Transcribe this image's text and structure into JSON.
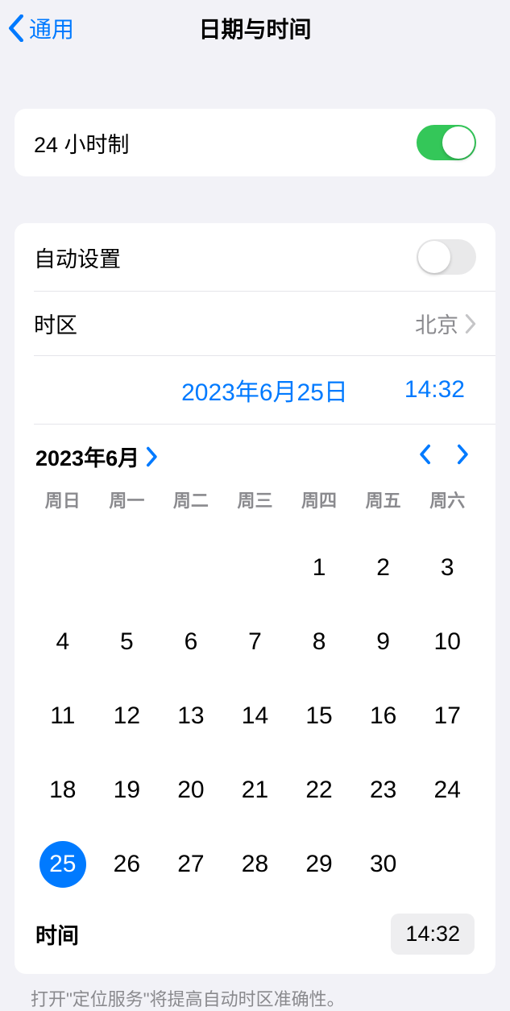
{
  "nav": {
    "back": "通用",
    "title": "日期与时间"
  },
  "s24": {
    "label": "24 小时制",
    "on": true
  },
  "auto": {
    "label": "自动设置",
    "on": false
  },
  "tz": {
    "label": "时区",
    "value": "北京"
  },
  "current": {
    "date": "2023年6月25日",
    "time": "14:32"
  },
  "cal": {
    "month_label": "2023年6月",
    "weekdays": [
      "周日",
      "周一",
      "周二",
      "周三",
      "周四",
      "周五",
      "周六"
    ],
    "leading_blanks": 4,
    "days_in_month": 30,
    "selected": 25
  },
  "time_row": {
    "label": "时间",
    "value": "14:32"
  },
  "footer": "打开\"定位服务\"将提高自动时区准确性。"
}
